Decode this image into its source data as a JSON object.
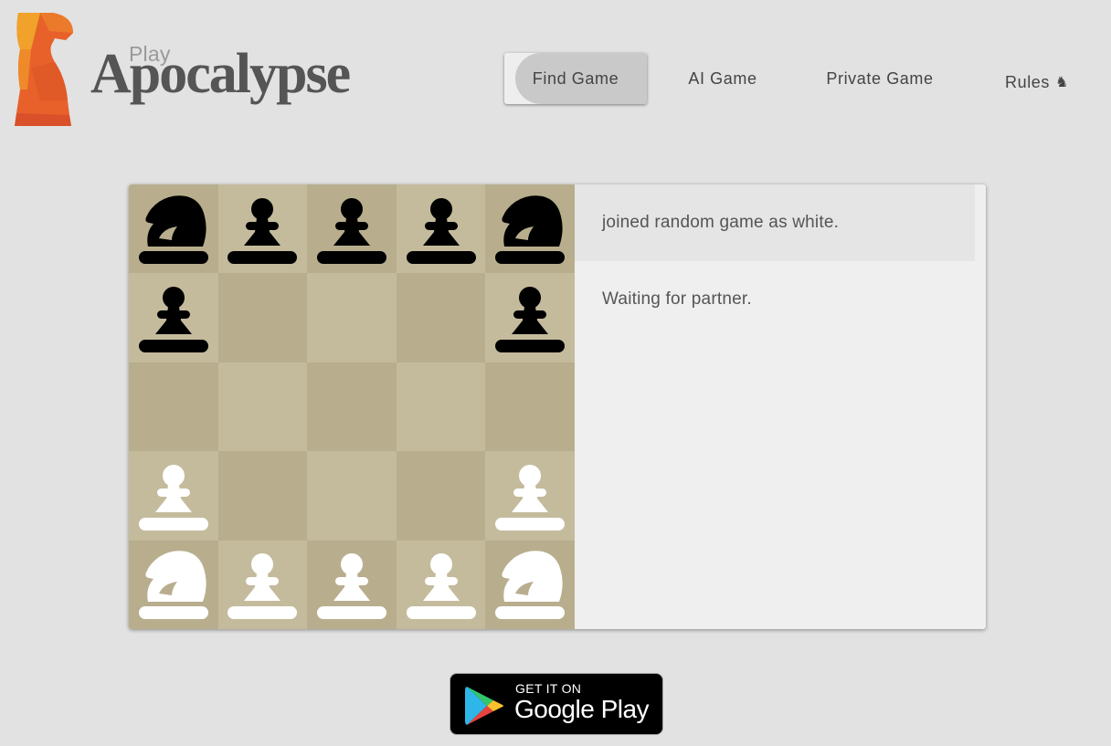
{
  "header": {
    "brand_small": "Play",
    "brand_big": "Apocalypse",
    "nav": {
      "find_game": "Find Game",
      "ai_game": "AI Game",
      "private_game": "Private Game",
      "rules": "Rules",
      "rules_icon": "♞"
    }
  },
  "colors": {
    "dark_square": "#b8ae8e",
    "light_square": "#c4bb9d",
    "logo_orange": "#e8612a"
  },
  "board": {
    "rows": [
      [
        {
          "color": "black",
          "type": "knight"
        },
        {
          "color": "black",
          "type": "pawn"
        },
        {
          "color": "black",
          "type": "pawn"
        },
        {
          "color": "black",
          "type": "pawn"
        },
        {
          "color": "black",
          "type": "knight"
        }
      ],
      [
        {
          "color": "black",
          "type": "pawn"
        },
        null,
        null,
        null,
        {
          "color": "black",
          "type": "pawn"
        }
      ],
      [
        null,
        null,
        null,
        null,
        null
      ],
      [
        {
          "color": "white",
          "type": "pawn"
        },
        null,
        null,
        null,
        {
          "color": "white",
          "type": "pawn"
        }
      ],
      [
        {
          "color": "white",
          "type": "knight"
        },
        {
          "color": "white",
          "type": "pawn"
        },
        {
          "color": "white",
          "type": "pawn"
        },
        {
          "color": "white",
          "type": "pawn"
        },
        {
          "color": "white",
          "type": "knight"
        }
      ]
    ]
  },
  "messages": [
    "joined random game as white.",
    "Waiting for partner."
  ],
  "store_badge": {
    "line1": "GET IT ON",
    "line2": "Google Play"
  }
}
